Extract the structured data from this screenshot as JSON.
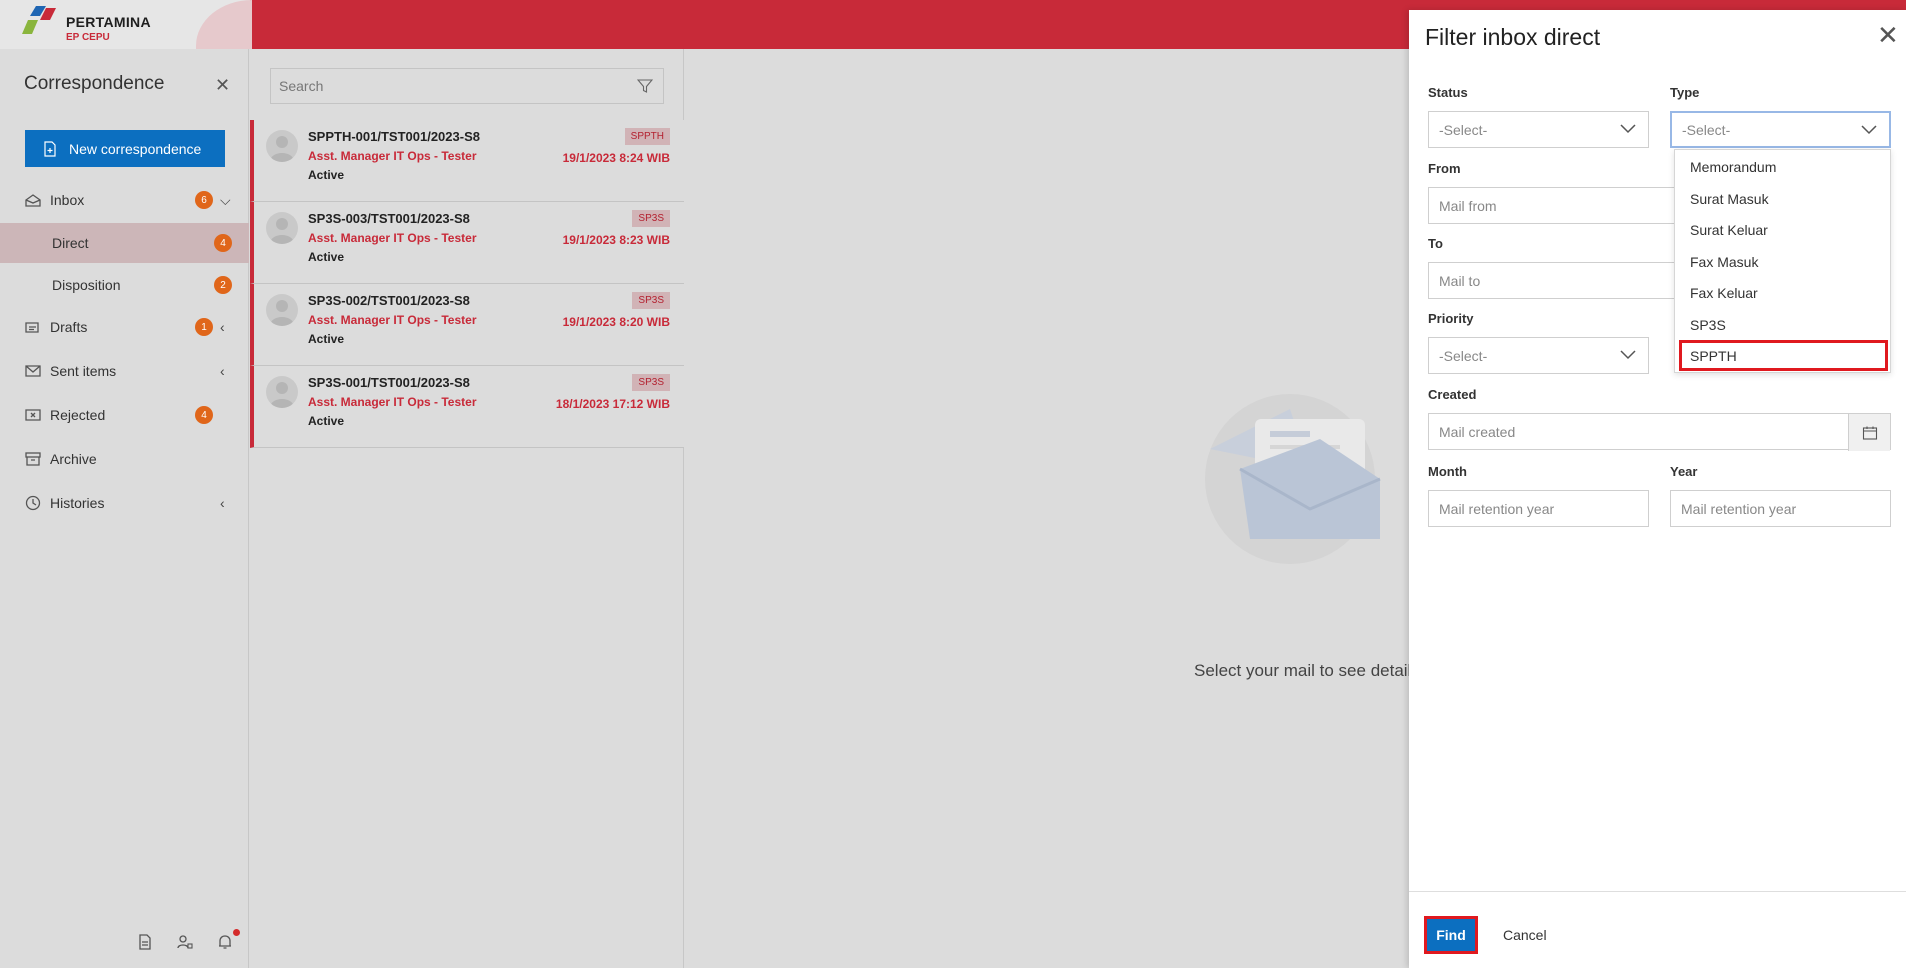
{
  "brand": {
    "name": "PERTAMINA",
    "sub": "EP CEPU"
  },
  "sidebar": {
    "title": "Correspondence",
    "new_button": "New correspondence",
    "items": [
      {
        "label": "Inbox",
        "badge": "6",
        "icon": "inbox-icon",
        "chevron": "down"
      },
      {
        "label": "Direct",
        "badge": "4",
        "sub": true,
        "active": true
      },
      {
        "label": "Disposition",
        "badge": "2",
        "sub": true
      },
      {
        "label": "Drafts",
        "badge": "1",
        "icon": "drafts-icon",
        "chevron": "left"
      },
      {
        "label": "Sent items",
        "icon": "sent-icon",
        "chevron": "left"
      },
      {
        "label": "Rejected",
        "badge": "4",
        "icon": "rejected-icon"
      },
      {
        "label": "Archive",
        "icon": "archive-icon"
      },
      {
        "label": "Histories",
        "icon": "history-icon",
        "chevron": "left"
      }
    ]
  },
  "search": {
    "placeholder": "Search"
  },
  "mails": [
    {
      "subject": "SPPTH-001/TST001/2023-S8",
      "sender": "Asst. Manager IT Ops - Tester",
      "status": "Active",
      "tag": "SPPTH",
      "time": "19/1/2023 8:24 WIB"
    },
    {
      "subject": "SP3S-003/TST001/2023-S8",
      "sender": "Asst. Manager IT Ops - Tester",
      "status": "Active",
      "tag": "SP3S",
      "time": "19/1/2023 8:23 WIB"
    },
    {
      "subject": "SP3S-002/TST001/2023-S8",
      "sender": "Asst. Manager IT Ops - Tester",
      "status": "Active",
      "tag": "SP3S",
      "time": "19/1/2023 8:20 WIB"
    },
    {
      "subject": "SP3S-001/TST001/2023-S8",
      "sender": "Asst. Manager IT Ops - Tester",
      "status": "Active",
      "tag": "SP3S",
      "time": "18/1/2023 17:12 WIB"
    }
  ],
  "detail": {
    "empty_message": "Select your mail to see detail"
  },
  "filter": {
    "title": "Filter inbox direct",
    "status": {
      "label": "Status",
      "value": "-Select-"
    },
    "type": {
      "label": "Type",
      "value": "-Select-",
      "options": [
        "Memorandum",
        "Surat Masuk",
        "Surat Keluar",
        "Fax Masuk",
        "Fax Keluar",
        "SP3S",
        "SPPTH"
      ],
      "highlighted": "SPPTH"
    },
    "from": {
      "label": "From",
      "placeholder": "Mail from"
    },
    "to": {
      "label": "To",
      "placeholder": "Mail to"
    },
    "priority": {
      "label": "Priority",
      "value": "-Select-"
    },
    "created": {
      "label": "Created",
      "placeholder": "Mail created"
    },
    "month": {
      "label": "Month",
      "placeholder": "Mail retention year"
    },
    "year": {
      "label": "Year",
      "placeholder": "Mail retention year"
    },
    "find": "Find",
    "cancel": "Cancel"
  },
  "colors": {
    "brand_red": "#c82a39",
    "primary_blue": "#0c6fc0",
    "badge_orange": "#e0661a",
    "highlight_red": "#e0191f"
  }
}
